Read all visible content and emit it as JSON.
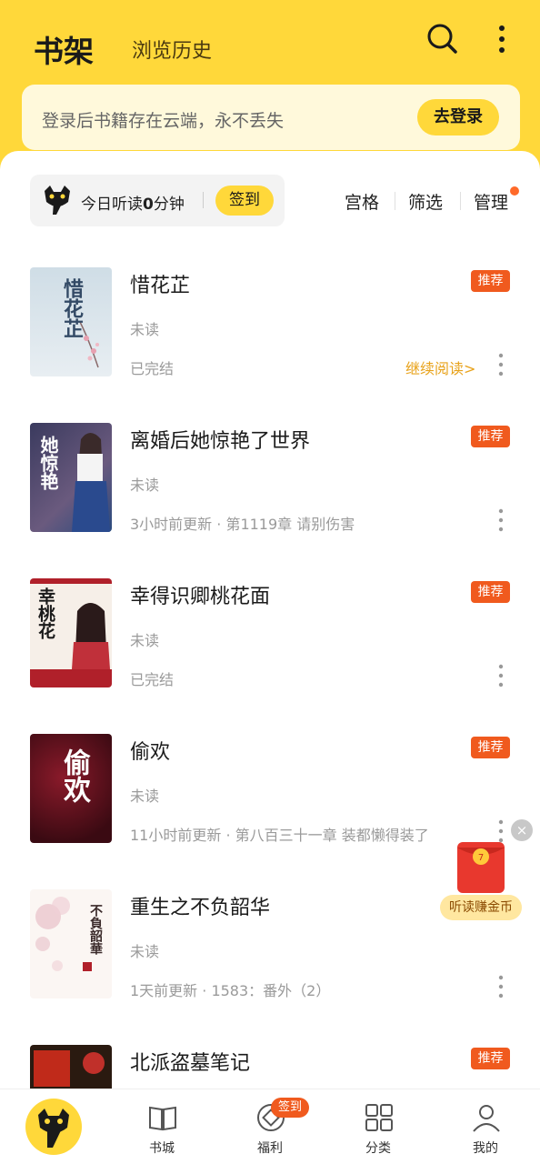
{
  "header": {
    "title": "书架",
    "history_tab": "浏览历史",
    "search_icon": "search-icon",
    "more_icon": "more-vertical-icon",
    "bg_color": "#FFD83A"
  },
  "login_banner": {
    "text": "登录后书籍存在云端，永不丢失",
    "button": "去登录"
  },
  "listen_bar": {
    "prefix": "今日听读",
    "minutes": "0",
    "suffix": "分钟",
    "checkin": "签到"
  },
  "tools": {
    "grid": "宫格",
    "filter": "筛选",
    "manage": "管理"
  },
  "books": [
    {
      "title": "惜花芷",
      "status": "未读",
      "update": "已完结",
      "badge": "推荐",
      "continue": "继续阅读>"
    },
    {
      "title": "离婚后她惊艳了世界",
      "status": "未读",
      "update": "3小时前更新 · 第1119章  请别伤害",
      "badge": "推荐"
    },
    {
      "title": "幸得识卿桃花面",
      "status": "未读",
      "update": "已完结",
      "badge": "推荐"
    },
    {
      "title": "偷欢",
      "status": "未读",
      "update": "11小时前更新 · 第八百三十一章 装都懒得装了",
      "badge": "推荐"
    },
    {
      "title": "重生之不负韶华",
      "status": "未读",
      "update": "1天前更新 · 1583：番外（2）",
      "badge": ""
    },
    {
      "title": "北派盗墓笔记",
      "status": "",
      "update": "",
      "badge": "推荐"
    }
  ],
  "float_ad": {
    "label": "听读赚金币",
    "close": "×"
  },
  "bottom_nav": {
    "items": [
      {
        "label": "书城",
        "icon": "book-open-icon"
      },
      {
        "label": "福利",
        "icon": "coin-icon",
        "badge": "签到"
      },
      {
        "label": "分类",
        "icon": "grid-icon"
      },
      {
        "label": "我的",
        "icon": "user-icon"
      }
    ]
  }
}
